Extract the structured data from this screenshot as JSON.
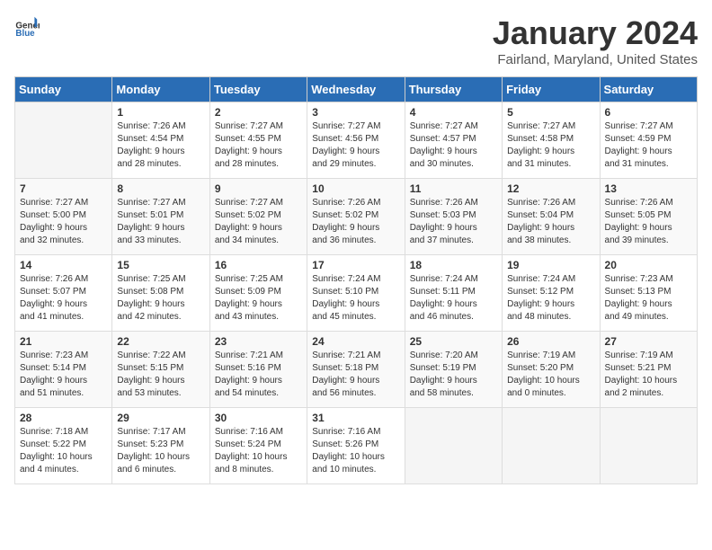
{
  "header": {
    "logo_general": "General",
    "logo_blue": "Blue",
    "title": "January 2024",
    "subtitle": "Fairland, Maryland, United States"
  },
  "weekdays": [
    "Sunday",
    "Monday",
    "Tuesday",
    "Wednesday",
    "Thursday",
    "Friday",
    "Saturday"
  ],
  "weeks": [
    [
      {
        "day": "",
        "info": ""
      },
      {
        "day": "1",
        "info": "Sunrise: 7:26 AM\nSunset: 4:54 PM\nDaylight: 9 hours\nand 28 minutes."
      },
      {
        "day": "2",
        "info": "Sunrise: 7:27 AM\nSunset: 4:55 PM\nDaylight: 9 hours\nand 28 minutes."
      },
      {
        "day": "3",
        "info": "Sunrise: 7:27 AM\nSunset: 4:56 PM\nDaylight: 9 hours\nand 29 minutes."
      },
      {
        "day": "4",
        "info": "Sunrise: 7:27 AM\nSunset: 4:57 PM\nDaylight: 9 hours\nand 30 minutes."
      },
      {
        "day": "5",
        "info": "Sunrise: 7:27 AM\nSunset: 4:58 PM\nDaylight: 9 hours\nand 31 minutes."
      },
      {
        "day": "6",
        "info": "Sunrise: 7:27 AM\nSunset: 4:59 PM\nDaylight: 9 hours\nand 31 minutes."
      }
    ],
    [
      {
        "day": "7",
        "info": "Sunrise: 7:27 AM\nSunset: 5:00 PM\nDaylight: 9 hours\nand 32 minutes."
      },
      {
        "day": "8",
        "info": "Sunrise: 7:27 AM\nSunset: 5:01 PM\nDaylight: 9 hours\nand 33 minutes."
      },
      {
        "day": "9",
        "info": "Sunrise: 7:27 AM\nSunset: 5:02 PM\nDaylight: 9 hours\nand 34 minutes."
      },
      {
        "day": "10",
        "info": "Sunrise: 7:26 AM\nSunset: 5:02 PM\nDaylight: 9 hours\nand 36 minutes."
      },
      {
        "day": "11",
        "info": "Sunrise: 7:26 AM\nSunset: 5:03 PM\nDaylight: 9 hours\nand 37 minutes."
      },
      {
        "day": "12",
        "info": "Sunrise: 7:26 AM\nSunset: 5:04 PM\nDaylight: 9 hours\nand 38 minutes."
      },
      {
        "day": "13",
        "info": "Sunrise: 7:26 AM\nSunset: 5:05 PM\nDaylight: 9 hours\nand 39 minutes."
      }
    ],
    [
      {
        "day": "14",
        "info": "Sunrise: 7:26 AM\nSunset: 5:07 PM\nDaylight: 9 hours\nand 41 minutes."
      },
      {
        "day": "15",
        "info": "Sunrise: 7:25 AM\nSunset: 5:08 PM\nDaylight: 9 hours\nand 42 minutes."
      },
      {
        "day": "16",
        "info": "Sunrise: 7:25 AM\nSunset: 5:09 PM\nDaylight: 9 hours\nand 43 minutes."
      },
      {
        "day": "17",
        "info": "Sunrise: 7:24 AM\nSunset: 5:10 PM\nDaylight: 9 hours\nand 45 minutes."
      },
      {
        "day": "18",
        "info": "Sunrise: 7:24 AM\nSunset: 5:11 PM\nDaylight: 9 hours\nand 46 minutes."
      },
      {
        "day": "19",
        "info": "Sunrise: 7:24 AM\nSunset: 5:12 PM\nDaylight: 9 hours\nand 48 minutes."
      },
      {
        "day": "20",
        "info": "Sunrise: 7:23 AM\nSunset: 5:13 PM\nDaylight: 9 hours\nand 49 minutes."
      }
    ],
    [
      {
        "day": "21",
        "info": "Sunrise: 7:23 AM\nSunset: 5:14 PM\nDaylight: 9 hours\nand 51 minutes."
      },
      {
        "day": "22",
        "info": "Sunrise: 7:22 AM\nSunset: 5:15 PM\nDaylight: 9 hours\nand 53 minutes."
      },
      {
        "day": "23",
        "info": "Sunrise: 7:21 AM\nSunset: 5:16 PM\nDaylight: 9 hours\nand 54 minutes."
      },
      {
        "day": "24",
        "info": "Sunrise: 7:21 AM\nSunset: 5:18 PM\nDaylight: 9 hours\nand 56 minutes."
      },
      {
        "day": "25",
        "info": "Sunrise: 7:20 AM\nSunset: 5:19 PM\nDaylight: 9 hours\nand 58 minutes."
      },
      {
        "day": "26",
        "info": "Sunrise: 7:19 AM\nSunset: 5:20 PM\nDaylight: 10 hours\nand 0 minutes."
      },
      {
        "day": "27",
        "info": "Sunrise: 7:19 AM\nSunset: 5:21 PM\nDaylight: 10 hours\nand 2 minutes."
      }
    ],
    [
      {
        "day": "28",
        "info": "Sunrise: 7:18 AM\nSunset: 5:22 PM\nDaylight: 10 hours\nand 4 minutes."
      },
      {
        "day": "29",
        "info": "Sunrise: 7:17 AM\nSunset: 5:23 PM\nDaylight: 10 hours\nand 6 minutes."
      },
      {
        "day": "30",
        "info": "Sunrise: 7:16 AM\nSunset: 5:24 PM\nDaylight: 10 hours\nand 8 minutes."
      },
      {
        "day": "31",
        "info": "Sunrise: 7:16 AM\nSunset: 5:26 PM\nDaylight: 10 hours\nand 10 minutes."
      },
      {
        "day": "",
        "info": ""
      },
      {
        "day": "",
        "info": ""
      },
      {
        "day": "",
        "info": ""
      }
    ]
  ]
}
